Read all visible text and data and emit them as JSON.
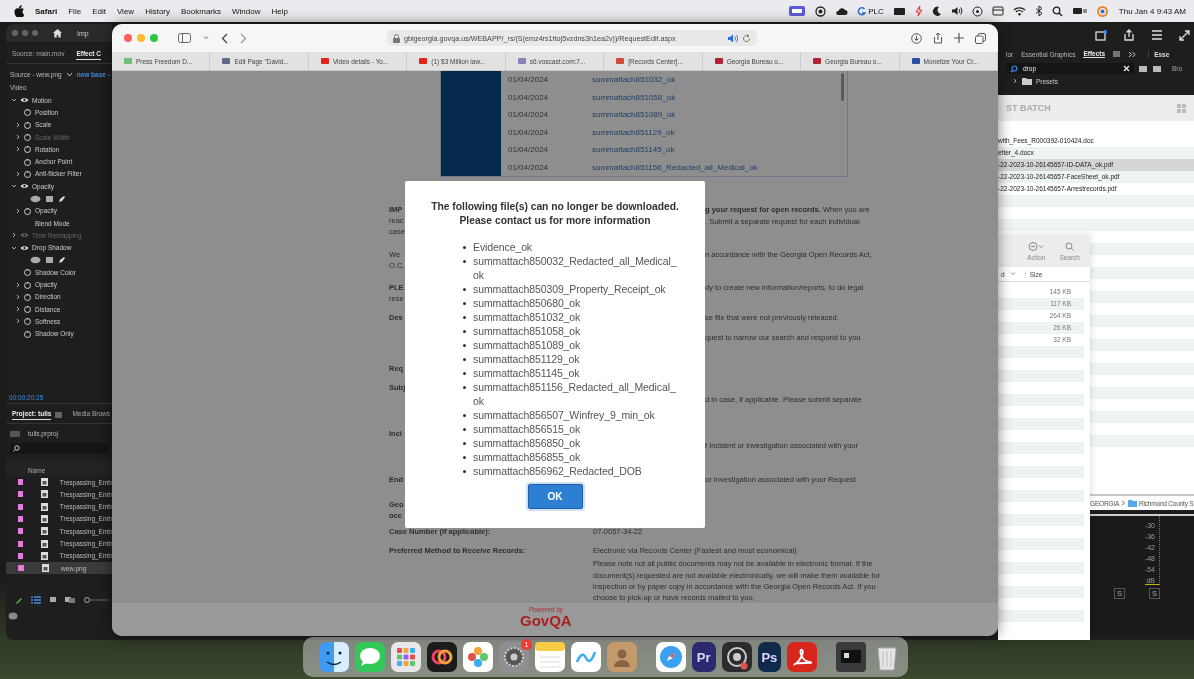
{
  "menu_bar": {
    "app": "Safari",
    "menus": [
      "File",
      "Edit",
      "View",
      "History",
      "Bookmarks",
      "Window",
      "Help"
    ],
    "status_label": "PLC",
    "clock": "Thu Jan 4  9:43 AM"
  },
  "premiere": {
    "window_title": "Imp",
    "panel_tabs": [
      {
        "label": "Source: main.mov",
        "selected": false
      },
      {
        "label": "Effect C",
        "selected": true
      }
    ],
    "source_clip": "Source - wew.png",
    "sequence": "new base -",
    "section": "Video",
    "effects": [
      {
        "label": "Motion",
        "expanded": true,
        "children": [
          {
            "kind": "param",
            "label": "Position",
            "disabled": false
          },
          {
            "kind": "group",
            "label": "Scale",
            "disabled": false
          },
          {
            "kind": "group",
            "label": "Scale Width",
            "disabled": true
          },
          {
            "kind": "group",
            "label": "Rotation",
            "disabled": false
          },
          {
            "kind": "param",
            "label": "Anchor Point",
            "disabled": false
          },
          {
            "kind": "group",
            "label": "Anti-flicker Filter",
            "disabled": false
          }
        ]
      },
      {
        "label": "Opacity",
        "expanded": true,
        "children": [
          {
            "kind": "masks"
          },
          {
            "kind": "group",
            "label": "Opacity",
            "disabled": false
          },
          {
            "kind": "plain",
            "label": "Blend Mode",
            "disabled": false
          }
        ]
      },
      {
        "label": "Time Remapping",
        "expanded": false
      },
      {
        "label": "Drop Shadow",
        "expanded": true,
        "children": [
          {
            "kind": "masks"
          },
          {
            "kind": "param",
            "label": "Shadow Color",
            "disabled": false
          },
          {
            "kind": "group",
            "label": "Opacity",
            "disabled": false
          },
          {
            "kind": "group",
            "label": "Direction",
            "disabled": false
          },
          {
            "kind": "group",
            "label": "Distance",
            "disabled": false
          },
          {
            "kind": "group",
            "label": "Softness",
            "disabled": false
          },
          {
            "kind": "param",
            "label": "Shadow Only",
            "disabled": false
          }
        ]
      }
    ],
    "timecode": "00:00:20:25",
    "project_tabs": [
      {
        "label": "Project: tulis",
        "selected": true
      },
      {
        "label": "Media Brows",
        "selected": false
      }
    ],
    "project_file": "tulis.prproj",
    "column_header": "Name",
    "items": [
      {
        "name": "Trespassing_Emb",
        "color": "#e27be0",
        "selected": false
      },
      {
        "name": "Trespassing_Emb",
        "color": "#e27be0",
        "selected": false
      },
      {
        "name": "Trespassing_Emb",
        "color": "#e27be0",
        "selected": false
      },
      {
        "name": "Trespassing_Emb",
        "color": "#e27be0",
        "selected": false
      },
      {
        "name": "Trespassing_Emb",
        "color": "#e27be0",
        "selected": false
      },
      {
        "name": "Trespassing_Emb",
        "color": "#e27be0",
        "selected": false
      },
      {
        "name": "Trespassing_Emb",
        "color": "#e27be0",
        "selected": false
      },
      {
        "name": "wew.png",
        "color": "#e27be0",
        "selected": true
      }
    ],
    "right_tabs": [
      {
        "label": "lor",
        "selected": false
      },
      {
        "label": "Essential Graphics",
        "selected": false
      },
      {
        "label": "Effects",
        "selected": true
      }
    ],
    "far_tab": "Esse",
    "side_label": "Bro",
    "effects_search": "drop",
    "presets_folder": "Presets",
    "meter_ticks": [
      "-30",
      "-36",
      "-42",
      "-48",
      "-54",
      "dB"
    ],
    "solo_buttons": [
      "S",
      "S"
    ]
  },
  "safari": {
    "url": "gbigeorgia.govqa.us/WEBAPP/_rs/(S(emz4rs1ttoj5vzdns3h1ea2v))/RequestEdit.aspx",
    "tabs": [
      {
        "title": "Press Freedom D...",
        "color": "#6fbf73"
      },
      {
        "title": "Edit Page \"David...",
        "color": "#5a6b8c"
      },
      {
        "title": "Video details - Yo...",
        "color": "#e62117"
      },
      {
        "title": "(1) $3 Million law...",
        "color": "#e62117"
      },
      {
        "title": "s6.voscast.com:7...",
        "color": "#8a83b8"
      },
      {
        "title": "[Records Center]...",
        "color": "#d44638"
      },
      {
        "title": "Georgia Bureau o...",
        "color": "#b22234"
      },
      {
        "title": "Georgia Bureau o...",
        "color": "#b22234"
      },
      {
        "title": "Monetize Your Cr...",
        "color": "#2c4fa3"
      }
    ],
    "documents": [
      {
        "date": "01/04/2024",
        "name": "summattach851032_ok"
      },
      {
        "date": "01/04/2024",
        "name": "summattach851058_ok"
      },
      {
        "date": "01/04/2024",
        "name": "summattach851089_ok"
      },
      {
        "date": "01/04/2024",
        "name": "summattach851129_ok"
      },
      {
        "date": "01/04/2024",
        "name": "summattach851145_ok"
      },
      {
        "date": "01/04/2024",
        "name": "summattach851156_Redacted_all_Medical_ok"
      }
    ],
    "form_rows": [
      {
        "kind": "covered",
        "label": [
          {
            "text": "IMP",
            "bold": true
          },
          {
            "text": "reac",
            "bold": false
          },
          {
            "text": "case",
            "bold": false
          }
        ],
        "value": [
          "**g your request for open records.** When you are",
          ". Submit a separate request for each individual"
        ]
      },
      {
        "kind": "covered",
        "label": [
          {
            "text": "We",
            "bold": false
          },
          {
            "text": "O.C.",
            "bold": false
          }
        ],
        "value": [
          "n accordance with the Georgia Open Records Act,"
        ]
      },
      {
        "kind": "covered",
        "label": [
          {
            "text": "PLE",
            "bold": true
          },
          {
            "text": "rese",
            "bold": false
          }
        ],
        "value": [
          "dy to create new information/reports, to do legal"
        ]
      },
      {
        "kind": "covered",
        "label": [
          {
            "text": "Des",
            "bold": true
          }
        ],
        "value": [
          "se file that were not previously released.",
          "quest to narrow our search and respond to you"
        ]
      },
      {
        "kind": "covered",
        "label": [
          {
            "text": "Req",
            "bold": true
          }
        ],
        "value": []
      },
      {
        "kind": "covered",
        "label": [
          {
            "text": "Subj",
            "bold": true
          }
        ],
        "value": [
          "d in case, if applicable. Please submit separate"
        ]
      },
      {
        "kind": "covered",
        "label": [
          {
            "text": "Inci",
            "bold": true
          }
        ],
        "value": [
          "f Incident or investigation associated with your"
        ]
      },
      {
        "kind": "covered",
        "label": [
          {
            "text": "End",
            "bold": true
          }
        ],
        "value": [
          "or Investigation associated with your Request"
        ]
      },
      {
        "kind": "covered",
        "label": [
          {
            "text": "Geo",
            "bold": true
          },
          {
            "text": "occ",
            "bold": true
          }
        ],
        "value": []
      },
      {
        "kind": "full",
        "label": [
          {
            "text": "Case Number (if applicable):",
            "bold": true
          }
        ],
        "value": [
          "07-0057-34-22"
        ]
      },
      {
        "kind": "full",
        "label": [
          {
            "text": "Preferred Method to Receive Records:",
            "bold": true
          }
        ],
        "value": [
          "Electronic via Records Center (Fastest and most economical)",
          "Please note not all public documents may not be available in electronic format. If the document(s) requested are not available electronically, we will make them available for inspection or by paper copy in accordance with the Georgia Open Records Act. If you choose to pick-up or have records mailed to you,"
        ]
      }
    ],
    "footer": {
      "powered_by": "Powered by",
      "logo": "GovQA"
    },
    "dialog": {
      "title_lines": [
        "The following file(s) can no longer be downloaded.",
        "Please contact us for more information"
      ],
      "files": [
        "Evidence_ok",
        "summattach850032_Redacted_all_Medical_ok",
        "summattach850309_Property_Receipt_ok",
        "summattach850680_ok",
        "summattach851032_ok",
        "summattach851058_ok",
        "summattach851089_ok",
        "summattach851129_ok",
        "summattach851145_ok",
        "summattach851156_Redacted_all_Medical_ok",
        "summattach856507_Winfrey_9_min_ok",
        "summattach856515_ok",
        "summattach856850_ok",
        "summattach856855_ok",
        "summattach856962_Redacted_DOB"
      ],
      "button": "OK"
    }
  },
  "finder_back": {
    "title": "ST BATCH",
    "files": [
      {
        "name": "with_Fees_R000392-010424.doc",
        "selected": false
      },
      {
        "name": "etter_4.docx",
        "selected": false
      },
      {
        "name": "-22-2023-10-26145657-ID-DATA_ok.pdf",
        "selected": true
      },
      {
        "name": "-22-2023-10-26145657-FaceSheet_ok.pdf",
        "selected": false
      },
      {
        "name": "-22-2023-10-26145657-Arrestrecords.pdf",
        "selected": false
      }
    ],
    "path": [
      "GEORGIA",
      "Richmond County S"
    ]
  },
  "finder_front": {
    "toolbar": [
      "Action",
      "Search"
    ],
    "columns": [
      "d",
      "Size"
    ],
    "sizes": [
      "145 KB",
      "117 KB",
      "264 KB",
      "26 KB",
      "32 KB"
    ]
  },
  "dock": [
    {
      "kind": "finder"
    },
    {
      "kind": "messages"
    },
    {
      "kind": "launchpad"
    },
    {
      "kind": "swirl"
    },
    {
      "kind": "photos"
    },
    {
      "kind": "settings",
      "badge": "1"
    },
    {
      "kind": "notes"
    },
    {
      "kind": "freeform"
    },
    {
      "kind": "contacts"
    },
    {
      "kind": "divider"
    },
    {
      "kind": "safari"
    },
    {
      "kind": "text",
      "label": "Pr",
      "color": "#2a2a6e"
    },
    {
      "kind": "camera"
    },
    {
      "kind": "text",
      "label": "Ps",
      "color": "#0f2a4a"
    },
    {
      "kind": "acrobat"
    },
    {
      "kind": "divider"
    },
    {
      "kind": "screen"
    },
    {
      "kind": "trash"
    }
  ]
}
